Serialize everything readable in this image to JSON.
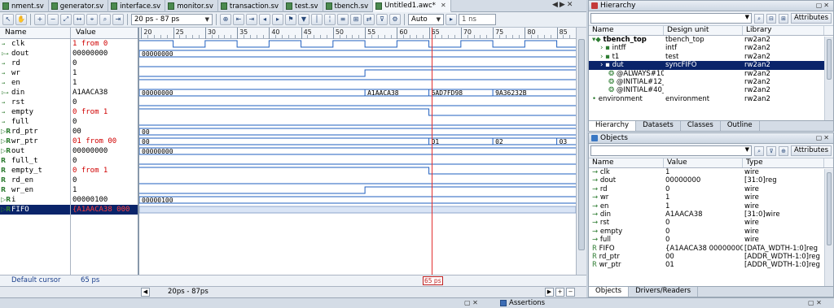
{
  "tabs": [
    {
      "label": "nment.sv",
      "active": false
    },
    {
      "label": "generator.sv",
      "active": false
    },
    {
      "label": "interface.sv",
      "active": false
    },
    {
      "label": "monitor.sv",
      "active": false
    },
    {
      "label": "transaction.sv",
      "active": false
    },
    {
      "label": "test.sv",
      "active": false
    },
    {
      "label": "tbench.sv",
      "active": false
    },
    {
      "label": "Untitled1.awc*",
      "active": true
    }
  ],
  "toolbar": {
    "time_range": "20 ps - 87 ps",
    "zoom_mode": "Auto",
    "step_value": "1 ns"
  },
  "waveform": {
    "name_header": "Name",
    "value_header": "Value",
    "signals": [
      {
        "name": "clk",
        "value": "1",
        "suffix": " from 0",
        "kind": "in"
      },
      {
        "name": "dout",
        "value": "00000000",
        "suffix": "",
        "kind": "out",
        "expand": true
      },
      {
        "name": "rd",
        "value": "0",
        "suffix": "",
        "kind": "in"
      },
      {
        "name": "wr",
        "value": "1",
        "suffix": "",
        "kind": "in"
      },
      {
        "name": "en",
        "value": "1",
        "suffix": "",
        "kind": "in"
      },
      {
        "name": "din",
        "value": "A1AACA38",
        "suffix": "",
        "kind": "in",
        "expand": true
      },
      {
        "name": "rst",
        "value": "0",
        "suffix": "",
        "kind": "in"
      },
      {
        "name": "empty",
        "value": "0",
        "suffix": " from 1",
        "kind": "in"
      },
      {
        "name": "full",
        "value": "0",
        "suffix": "",
        "kind": "in"
      },
      {
        "name": "rd_ptr",
        "value": "00",
        "suffix": "",
        "kind": "reg",
        "expand": true
      },
      {
        "name": "wr_ptr",
        "value": "01",
        "suffix": " from 00",
        "kind": "reg",
        "expand": true
      },
      {
        "name": "out",
        "value": "00000000",
        "suffix": "",
        "kind": "reg",
        "expand": true
      },
      {
        "name": "full_t",
        "value": "0",
        "suffix": "",
        "kind": "reg"
      },
      {
        "name": "empty_t",
        "value": "0",
        "suffix": " from 1",
        "kind": "reg"
      },
      {
        "name": "rd_en",
        "value": "0",
        "suffix": "",
        "kind": "reg"
      },
      {
        "name": "wr_en",
        "value": "1",
        "suffix": "",
        "kind": "reg"
      },
      {
        "name": "i",
        "value": "00000100",
        "suffix": "",
        "kind": "reg",
        "expand": true
      },
      {
        "name": "FIFO",
        "value": "{A1AACA38 000",
        "suffix": "",
        "kind": "reg",
        "expand": true,
        "selected": true
      }
    ],
    "time_ticks": [
      "20",
      "25",
      "30",
      "35",
      "40",
      "45",
      "50",
      "55",
      "60",
      "65",
      "70",
      "75",
      "80",
      "85"
    ],
    "bus_labels": {
      "dout": [
        "00000000"
      ],
      "din": [
        "00000000",
        "A1AACA38",
        "6AD7FD98",
        "9A36232B"
      ],
      "rd_ptr": [
        "00"
      ],
      "wr_ptr": [
        "00",
        "01",
        "02",
        "03"
      ],
      "out": [
        "00000000"
      ],
      "i": [
        "00000100"
      ]
    },
    "cursor_label": "Default cursor",
    "cursor_value": "65 ps",
    "cursor_marker": "65 ps",
    "visible_range": "20ps - 87ps"
  },
  "hierarchy": {
    "title": "Hierarchy",
    "attributes_label": "Attributes",
    "columns": [
      "Name",
      "Design unit",
      "Library"
    ],
    "rows": [
      {
        "name": "tbench_top",
        "unit": "tbench_top",
        "lib": "rw2an2",
        "indent": 0,
        "bold": true
      },
      {
        "name": "intff",
        "unit": "intf",
        "lib": "rw2an2",
        "indent": 1
      },
      {
        "name": "t1",
        "unit": "test",
        "lib": "rw2an2",
        "indent": 1
      },
      {
        "name": "dut",
        "unit": "syncFIFO",
        "lib": "rw2an2",
        "indent": 1,
        "selected": true
      },
      {
        "name": "@ALWAYS#10",
        "unit": "",
        "lib": "rw2an2",
        "indent": 2
      },
      {
        "name": "@INITIAL#12_",
        "unit": "",
        "lib": "rw2an2",
        "indent": 2
      },
      {
        "name": "@INITIAL#40_",
        "unit": "",
        "lib": "rw2an2",
        "indent": 2
      },
      {
        "name": "environment",
        "unit": "environment",
        "lib": "rw2an2",
        "indent": 0
      }
    ],
    "tabs": [
      "Hierarchy",
      "Datasets",
      "Classes",
      "Outline"
    ]
  },
  "objects": {
    "title": "Objects",
    "attributes_label": "Attributes",
    "columns": [
      "Name",
      "Value",
      "Type"
    ],
    "rows": [
      {
        "name": "clk",
        "value": "1",
        "type": "wire"
      },
      {
        "name": "dout",
        "value": "00000000",
        "type": "[31:0]reg"
      },
      {
        "name": "rd",
        "value": "0",
        "type": "wire"
      },
      {
        "name": "wr",
        "value": "1",
        "type": "wire"
      },
      {
        "name": "en",
        "value": "1",
        "type": "wire"
      },
      {
        "name": "din",
        "value": "A1AACA38",
        "type": "[31:0]wire"
      },
      {
        "name": "rst",
        "value": "0",
        "type": "wire"
      },
      {
        "name": "empty",
        "value": "0",
        "type": "wire"
      },
      {
        "name": "full",
        "value": "0",
        "type": "wire"
      },
      {
        "name": "FIFO",
        "value": "{A1AACA38 00000000",
        "type": "[DATA_WDTH-1:0]reg"
      },
      {
        "name": "rd_ptr",
        "value": "00",
        "type": "[ADDR_WDTH-1:0]reg"
      },
      {
        "name": "wr_ptr",
        "value": "01",
        "type": "[ADDR_WDTH-1:0]reg"
      }
    ],
    "tabs": [
      "Objects",
      "Drivers/Readers"
    ]
  },
  "bottom": {
    "assertions_label": "Assertions"
  }
}
